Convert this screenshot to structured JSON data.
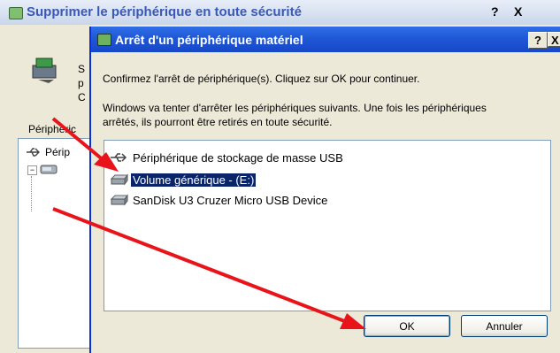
{
  "back_window": {
    "title": "Supprimer le périphérique en toute sécurité",
    "help_button": "?",
    "close_button": "X",
    "truncated_text": "S p C",
    "devices_label": "Périphéric",
    "tree_item": "Périp"
  },
  "dialog": {
    "title": "Arrêt d'un périphérique matériel",
    "help_button": "?",
    "close_button": "X",
    "confirm_text": "Confirmez l'arrêt de périphérique(s). Cliquez sur OK pour continuer.",
    "info_text": "Windows va tenter d'arrêter les périphériques suivants. Une fois les périphériques arrêtés, ils pourront être retirés en toute sécurité.",
    "devices": [
      {
        "label": "Périphérique de stockage de masse USB",
        "icon": "usb-icon",
        "selected": false
      },
      {
        "label": "Volume générique - (E:)",
        "icon": "drive-icon",
        "selected": true
      },
      {
        "label": "SanDisk U3 Cruzer Micro USB Device",
        "icon": "drive-icon",
        "selected": false
      }
    ],
    "ok_label": "OK",
    "cancel_label": "Annuler"
  },
  "colors": {
    "titlebar_active": "#1f58d6",
    "window_bg": "#ece9d8",
    "selection": "#0a246a",
    "annotation": "#e8141a"
  }
}
